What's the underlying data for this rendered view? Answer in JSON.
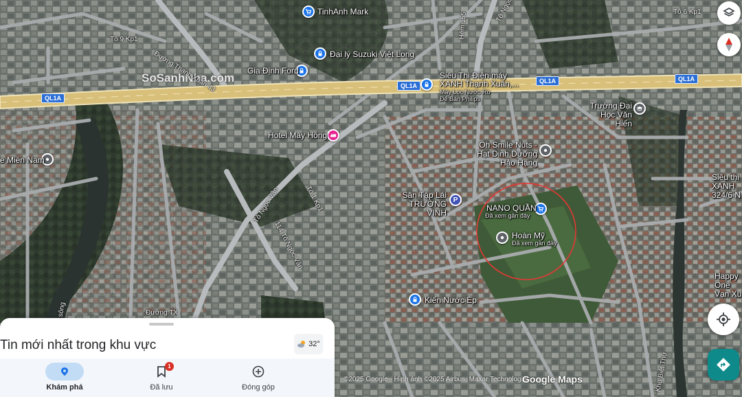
{
  "map": {
    "highway_badges": [
      "QL1A",
      "QL1A",
      "QL1A",
      "QL1A"
    ],
    "pois": [
      {
        "name": "TinhAnh Mark",
        "sub": "",
        "icon": "shopping-cart-icon",
        "color": "#1a73e8"
      },
      {
        "name": "Đại lý Suzuki Việt Long",
        "sub": "",
        "icon": "car-dealer-icon",
        "color": "#1a73e8"
      },
      {
        "name": "Gia Định Ford",
        "sub": "",
        "icon": "car-dealer-icon",
        "color": "#1a73e8"
      },
      {
        "name": "Siêu Thị Điện máy XANH Thạnh Xuân,...",
        "sub": "Máy Lọc Nước Ro Để Bàn Philips",
        "icon": "shopping-bag-icon",
        "color": "#1a73e8"
      },
      {
        "name": "Trường Đại Học Văn Hiến",
        "sub": "",
        "icon": "school-icon",
        "color": "#5f6368"
      },
      {
        "name": "Hotel Mây Hồng",
        "sub": "",
        "icon": "hotel-icon",
        "color": "#e52592"
      },
      {
        "name": "Oh Smile Nuts - Hạt Dinh Dưỡng Hảo Hạng",
        "sub": "",
        "icon": "place-icon",
        "color": "#5f6368"
      },
      {
        "name": "Sân Tập Lái TRƯỜNG VINH",
        "sub": "",
        "icon": "parking-icon",
        "color": "#3f51b5"
      },
      {
        "name": "NANO QUẦN",
        "sub": "Đã xem gần đây",
        "icon": "shopping-cart-icon",
        "color": "#1a73e8"
      },
      {
        "name": "Hoàn Mỹ",
        "sub": "Đã xem gần đây",
        "icon": "place-icon",
        "color": "#5f6368"
      },
      {
        "name": "Kiến Nước Ép",
        "sub": "",
        "icon": "shopping-bag-icon",
        "color": "#1a73e8"
      },
      {
        "name": "e Miền Nam",
        "sub": "",
        "icon": "place-icon",
        "color": "#5f6368"
      },
      {
        "name": "Siêu thị XANH 324/6 N",
        "sub": "",
        "icon": "",
        "color": ""
      },
      {
        "name": "Happy One Vạn Xu",
        "sub": "",
        "icon": "",
        "color": ""
      }
    ],
    "streets": [
      "Đường Thạnh Xuân 43",
      "Tô 9 Kp1",
      "Tô 6 Kp1",
      "Tô Ngọc",
      "Tô Ngọc Vân",
      "114 Tô Ngọc Vân",
      "Tô 1 Kp1",
      "Khu Biệt Thự",
      "sông",
      "Đường TX",
      "Hẻm 155"
    ],
    "watermark": "SoSanhNha.com"
  },
  "controls": {
    "layers_icon": "layers-icon",
    "compass_icon": "compass-icon",
    "locate_icon": "my-location-icon",
    "directions_icon": "directions-icon"
  },
  "sheet": {
    "title": "Tin mới nhất trong khu vực",
    "weather": "32°"
  },
  "nav": [
    {
      "label": "Khám phá",
      "icon": "explore-icon",
      "active": true
    },
    {
      "label": "Đã lưu",
      "icon": "bookmark-icon",
      "badge": "1"
    },
    {
      "label": "Đóng góp",
      "icon": "add-circle-icon"
    }
  ],
  "attribution": "©2025 Google · Hình ảnh ©2025 Airbus, Maxar Technologies",
  "logo": "Google Maps"
}
